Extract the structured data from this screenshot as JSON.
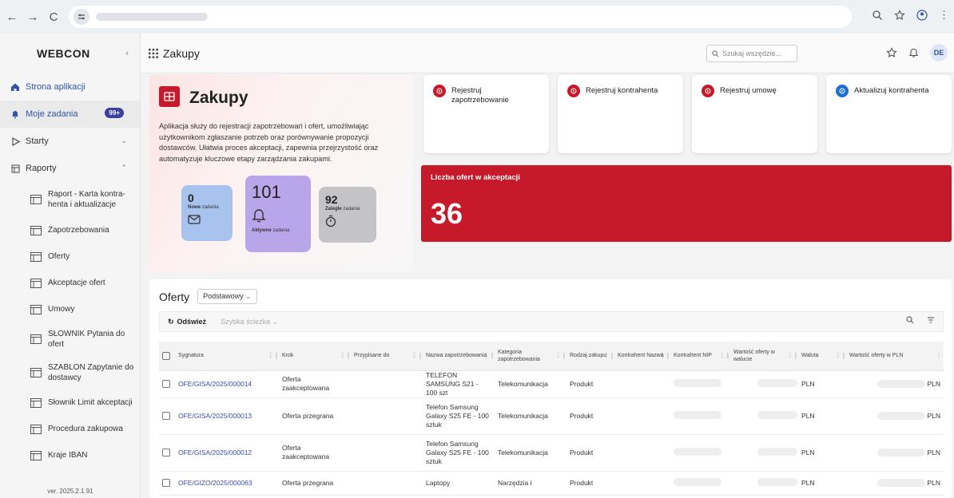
{
  "browser": {
    "url": ""
  },
  "sidebar": {
    "logo": "WEBCON",
    "items": [
      {
        "label": "Strona aplikacji"
      },
      {
        "label": "Moje zadania",
        "badge": "99+"
      },
      {
        "label": "Starty"
      },
      {
        "label": "Raporty"
      }
    ],
    "reports": [
      "Raport - Karta kontra-henta i aktualizacje",
      "Zapotrzebowania",
      "Oferty",
      "Akceptacje ofert",
      "Umowy",
      "SŁOWNIK Pytania do ofert",
      "SZABLON Zapytanie do dostawcy",
      "Słownik Limit akceptacji",
      "Procedura zakupowa",
      "Kraje IBAN"
    ],
    "version": "ver. 2025.2.1.91"
  },
  "topbar": {
    "title": "Zakupy",
    "search_placeholder": "Szukaj wszędzie...",
    "avatar": "DE"
  },
  "hero": {
    "title": "Zakupy",
    "description": "Aplikacja służy do rejestracji zapotrzebowań i ofert, umożliwiając użytkownikom zgłaszanie potrzeb oraz porównywanie propozycji dostawców. Ułatwia proces akceptacji, zapewnia przejrzystość oraz automatyzuje kluczowe etapy zarządzania zakupami.",
    "tiles": [
      {
        "value": "0",
        "label_bold": "Nowe",
        "label": "zadania"
      },
      {
        "value": "101",
        "label_bold": "Aktywne",
        "label": "zadania"
      },
      {
        "value": "92",
        "label_bold": "Zaległe",
        "label": "zadania"
      }
    ]
  },
  "actions": [
    {
      "label": "Rejestruj zapotrzebowanie",
      "color": "#c61a2b"
    },
    {
      "label": "Rejestruj kontrahenta",
      "color": "#c61a2b"
    },
    {
      "label": "Rejestruj umowę",
      "color": "#c61a2b"
    },
    {
      "label": "Aktualizuj kontrahenta",
      "color": "#1f6fd1"
    }
  ],
  "kpi": {
    "title": "Liczba ofert w akceptacji",
    "value": "36",
    "color": "#c61a2b"
  },
  "offers": {
    "title": "Oferty",
    "view": "Podstawowy",
    "refresh": "Odśwież",
    "quick_path": "Szybka ścieżka",
    "columns": [
      "Sygnatura",
      "Krok",
      "Przypisane do",
      "Nazwa zapotrzebowania",
      "Kategoria zapotrzebowania",
      "Rodzaj zakupu",
      "Kontrahent Nazwa",
      "Kontrahent NIP",
      "Wartość oferty w walucie",
      "Waluta",
      "Wartość oferty w PLN"
    ],
    "rows": [
      {
        "sig": "OFE/GISA/2025/000014",
        "step": "Oferta zaakceptowana",
        "name": "TELEFON SAMSUNG S21 - 100 szt",
        "category": "Telekomunikacja",
        "type": "Produkt",
        "currency": "PLN",
        "pln": "PLN"
      },
      {
        "sig": "OFE/GISA/2025/000013",
        "step": "Oferta przegrana",
        "name": "Telefon Samsung Galaxy S25 FE - 100 sztuk",
        "category": "Telekomunikacja",
        "type": "Produkt",
        "currency": "PLN",
        "pln": "PLN"
      },
      {
        "sig": "OFE/GISA/2025/000012",
        "step": "Oferta zaakceptowana",
        "name": "Telefon Samsung Galaxy S25 FE - 100 sztuk",
        "category": "Telekomunikacja",
        "type": "Produkt",
        "currency": "PLN",
        "pln": "PLN"
      },
      {
        "sig": "OFE/GIZO/2025/000063",
        "step": "Oferta przegrana",
        "name": "Laptopy",
        "category": "Narzędzia i",
        "type": "Produkt",
        "currency": "PLN",
        "pln": "PLN"
      }
    ]
  }
}
